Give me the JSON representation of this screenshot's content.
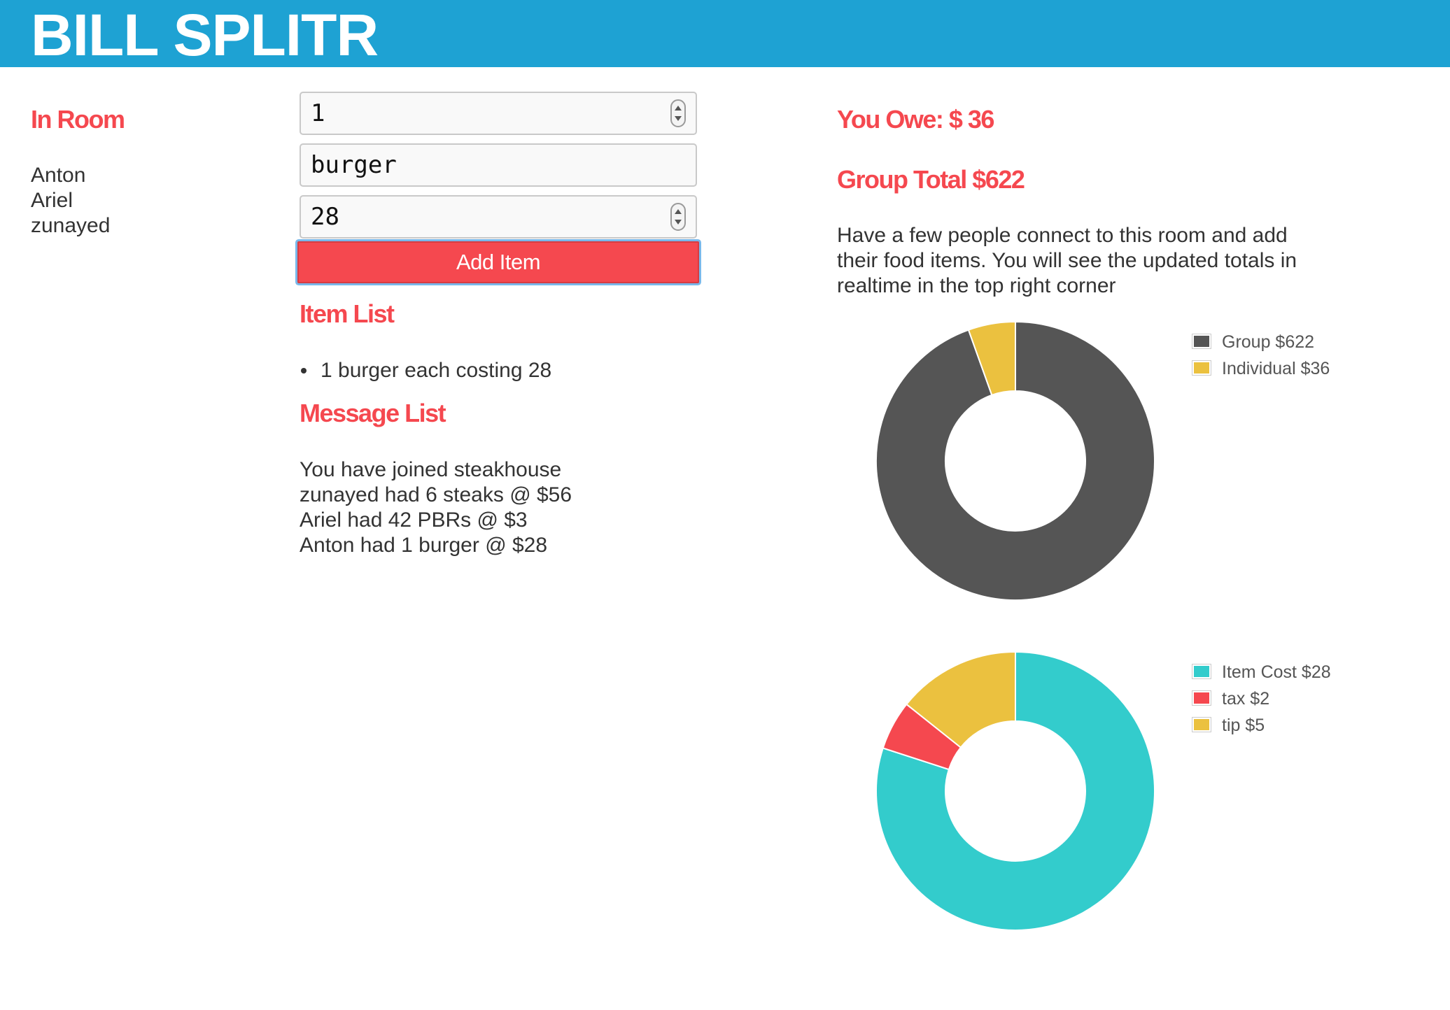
{
  "app": {
    "brand": "BILL SPLITR"
  },
  "room": {
    "heading": "In Room",
    "members": [
      "Anton",
      "Ariel",
      "zunayed"
    ]
  },
  "form": {
    "quantity_value": "1",
    "item_value": "burger",
    "price_value": "28",
    "add_button_label": "Add Item"
  },
  "items": {
    "heading": "Item List",
    "entries": [
      "1 burger each costing 28"
    ]
  },
  "messages": {
    "heading": "Message List",
    "entries": [
      "You have joined steakhouse",
      "zunayed had 6 steaks @ $56",
      "Ariel had 42 PBRs @ $3",
      "Anton had 1 burger @ $28"
    ]
  },
  "summary": {
    "you_owe": "You Owe: $ 36",
    "group_total": "Group Total $622",
    "instructions": [
      "Have a few people connect to this room and add",
      "their food items. You will see the updated totals in",
      "realtime in the top right corner"
    ]
  },
  "colors": {
    "brand_bar": "#1ea2d3",
    "accent_red": "#f5484f",
    "group_dark": "#555555",
    "yellow": "#ebc13f",
    "teal": "#33cccc"
  },
  "chart_data": [
    {
      "type": "pie",
      "labels": [
        "Group $622",
        "Individual $36"
      ],
      "values": [
        622,
        36
      ],
      "colors": [
        "#555555",
        "#ebc13f"
      ],
      "legend": "right"
    },
    {
      "type": "pie",
      "labels": [
        "Item Cost $28",
        "tax $2",
        "tip $5"
      ],
      "values": [
        28,
        2,
        5
      ],
      "colors": [
        "#33cccc",
        "#f5484f",
        "#ebc13f"
      ],
      "legend": "right"
    }
  ]
}
